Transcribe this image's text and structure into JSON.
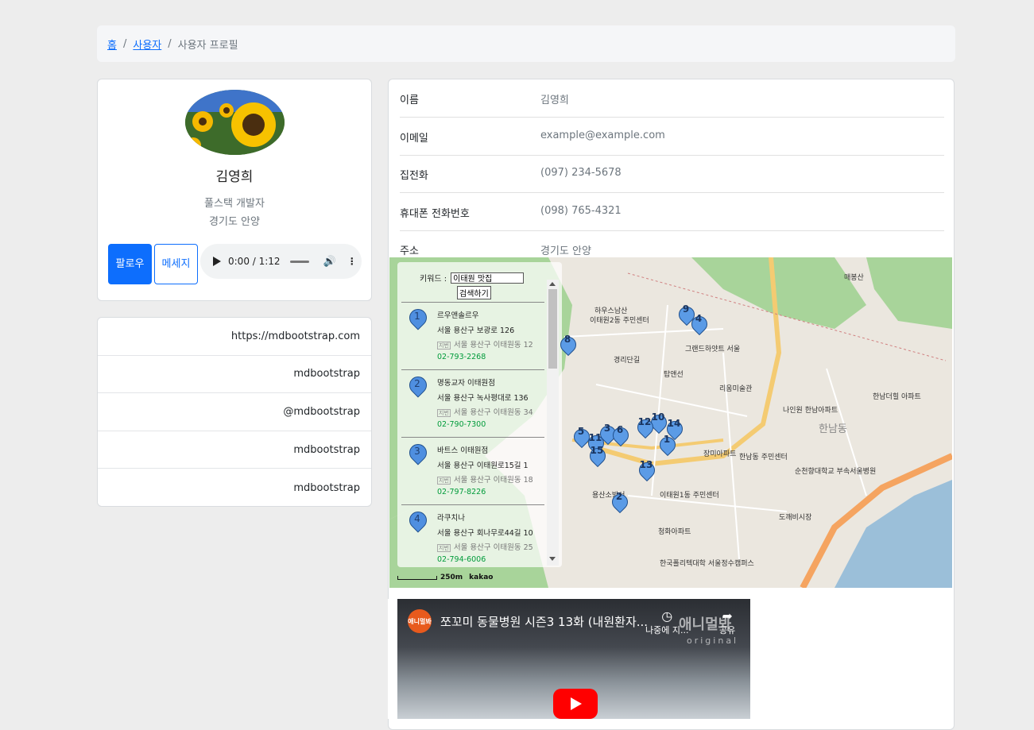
{
  "breadcrumb": {
    "home": "홈",
    "users": "사용자",
    "current": "사용자 프로필",
    "sep": "/"
  },
  "profile": {
    "name": "김영희",
    "role": "풀스택 개발자",
    "location": "경기도 안양",
    "follow_label": "팔로우",
    "message_label": "메세지",
    "audio": {
      "time": "0:00 / 1:12",
      "play_icon": "play-icon",
      "volume_icon": "volume-icon",
      "more_icon": "more-vert-icon"
    }
  },
  "links": [
    "https://mdbootstrap.com",
    "mdbootstrap",
    "@mdbootstrap",
    "mdbootstrap",
    "mdbootstrap"
  ],
  "info": {
    "name_label": "이름",
    "name_value": "김영희",
    "email_label": "이메일",
    "email_value": "example@example.com",
    "home_label": "집전화",
    "home_value": "(097) 234-5678",
    "mobile_label": "휴대폰 전화번호",
    "mobile_value": "(098) 765-4321",
    "address_label": "주소",
    "address_value": "경기도 안양"
  },
  "map": {
    "keyword_label": "키워드 :",
    "keyword_value": "이태원 맛집",
    "search_label": "검색하기",
    "jibun_tag": "지번",
    "places": [
      {
        "num": "1",
        "name": "르우앤솔르우",
        "addr": "서울 용산구 보광로 126",
        "jibun": "서울 용산구 이태원동 12",
        "tel": "02-793-2268"
      },
      {
        "num": "2",
        "name": "명동교자 이태원점",
        "addr": "서울 용산구 녹사평대로 136",
        "jibun": "서울 용산구 이태원동 34",
        "tel": "02-790-7300"
      },
      {
        "num": "3",
        "name": "바트스 이태원점",
        "addr": "서울 용산구 이태원로15길 1",
        "jibun": "서울 용산구 이태원동 18",
        "tel": "02-797-8226"
      },
      {
        "num": "4",
        "name": "라쿠치나",
        "addr": "서울 용산구 회나무로44길 10",
        "jibun": "서울 용산구 이태원동 25",
        "tel": "02-794-6006"
      }
    ],
    "scale": "250m",
    "brand": "kakao",
    "labels": [
      "이태원2동 주민센터",
      "경리단길",
      "탑앤선",
      "리움미술관",
      "그랜드하얏트 서울",
      "한남동 주민센터",
      "이태원1동 주민센터",
      "용산소방서",
      "한남동",
      "나인원 한남아파트",
      "순천향대학교 부속서울병원",
      "한남더힐 아파트",
      "도깨비시장",
      "한국폴리텍대학 서울정수캠퍼스",
      "장미아파트",
      "청화아파트",
      "하우스남산",
      "매봉산"
    ],
    "markers": [
      "1",
      "2",
      "3",
      "4",
      "5",
      "6",
      "8",
      "9",
      "10",
      "11",
      "12",
      "13",
      "14",
      "15"
    ]
  },
  "video": {
    "channel": "애니멀봐",
    "title": "쪼꼬미 동물병원 시즌3 13화 (내원환자...",
    "watch_later": "나중에 지...",
    "share": "공유",
    "logo": "애니멀봐",
    "logo_sub": "original"
  }
}
